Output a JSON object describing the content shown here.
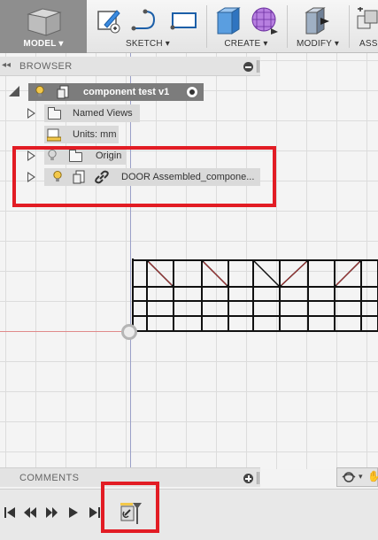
{
  "toolbar": {
    "model_label": "MODEL ▾",
    "sketch_label": "SKETCH ▾",
    "create_label": "CREATE ▾",
    "modify_label": "MODIFY ▾",
    "assemble_label": "ASS"
  },
  "browser": {
    "title": "BROWSER",
    "root_label": "component test v1",
    "items": [
      {
        "label": "Named Views"
      },
      {
        "label": "Units: mm"
      },
      {
        "label": "Origin"
      },
      {
        "label": "DOOR Assembled_compone..."
      }
    ]
  },
  "comments": {
    "title": "COMMENTS"
  },
  "colors": {
    "highlight": "#e21c24",
    "toolbar_active": "#8e8e8e",
    "node_dark": "#7c7c7c",
    "bulb": "#f3c84a"
  },
  "icons": [
    "cube-icon",
    "sketch-icon",
    "line-icon",
    "rectangle-icon",
    "extrude-icon",
    "form-icon",
    "press-pull-icon",
    "joint-icon",
    "lightbulb-icon",
    "component-icon",
    "folder-icon",
    "link-icon",
    "units-icon",
    "orbit-icon",
    "first-icon",
    "prev-icon",
    "play-icon",
    "next-icon",
    "last-icon",
    "timeline-feature-icon"
  ]
}
